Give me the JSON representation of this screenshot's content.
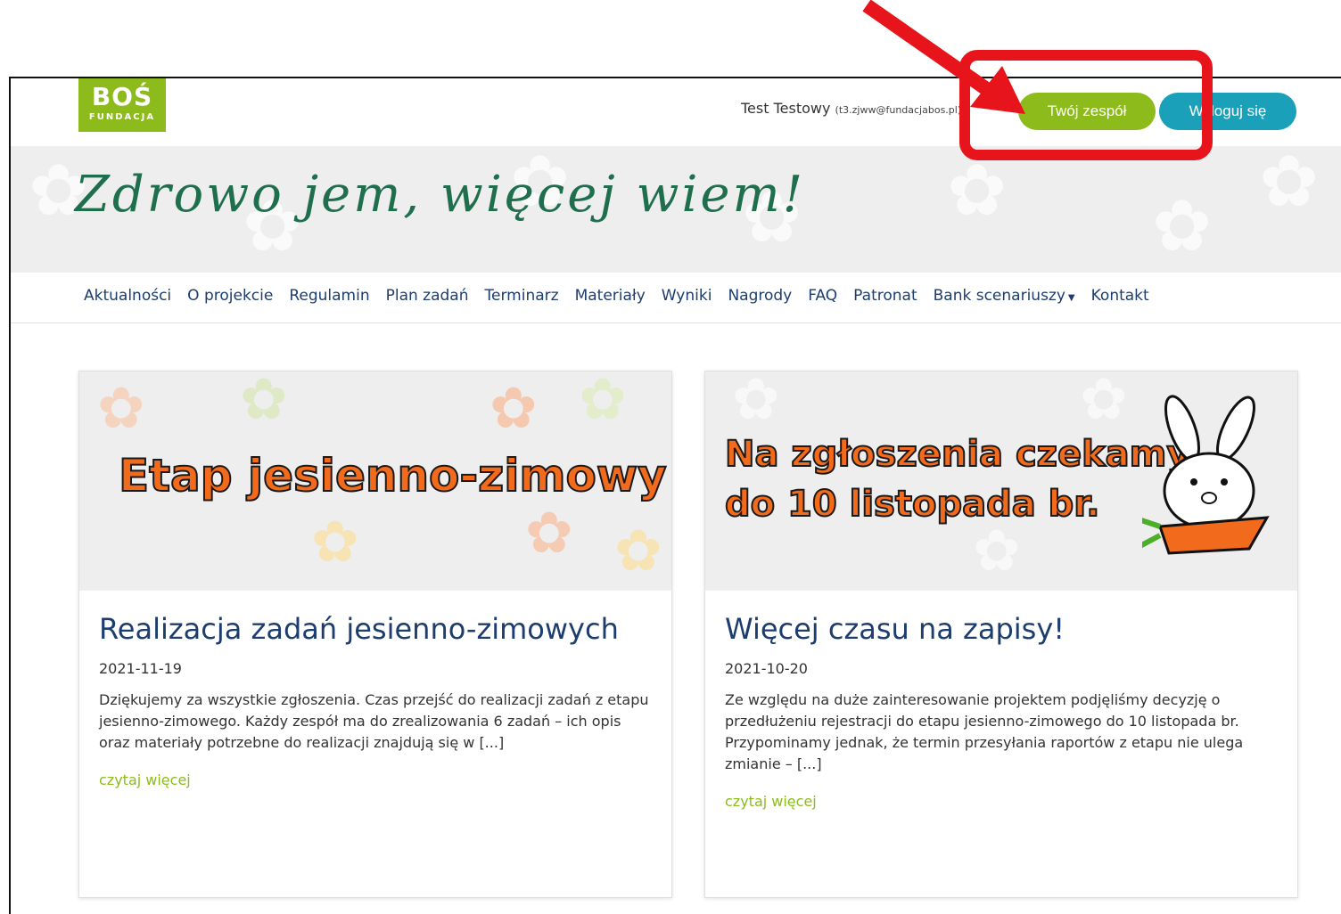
{
  "header": {
    "logo_big": "BOŚ",
    "logo_small": "FUNDACJA",
    "user_name": "Test Testowy",
    "user_email": "(t3.zjww@fundacjabos.pl)",
    "team_button": "Twój zespół",
    "logout_button": "Wyloguj się"
  },
  "banner": {
    "title": "Zdrowo jem, więcej wiem!"
  },
  "nav": {
    "items": [
      "Aktualności",
      "O projekcie",
      "Regulamin",
      "Plan zadań",
      "Terminarz",
      "Materiały",
      "Wyniki",
      "Nagrody",
      "FAQ",
      "Patronat",
      "Bank scenariuszy",
      "Kontakt"
    ]
  },
  "cards": [
    {
      "image_text": "Etap jesienno-zimowy",
      "title": "Realizacja zadań jesienno-zimowych",
      "date": "2021-11-19",
      "excerpt": "Dziękujemy za wszystkie zgłoszenia. Czas przejść do realizacji zadań z etapu jesienno-zimowego. Każdy zespół ma do zrealizowania 6 zadań – ich opis oraz materiały potrzebne do realizacji znajdują się w [...]",
      "more": "czytaj więcej"
    },
    {
      "image_text_line1": "Na zgłoszenia czekamy",
      "image_text_line2": "do 10 listopada br.",
      "title": "Więcej czasu na zapisy!",
      "date": "2021-10-20",
      "excerpt": "Ze względu na duże zainteresowanie projektem podjęliśmy decyzję o przedłużeniu rejestracji do etapu jesienno-zimowego do 10 listopada br. Przypominamy jednak, że termin przesyłania raportów z etapu nie ulega zmianie – [...]",
      "more": "czytaj więcej"
    }
  ],
  "colors": {
    "accent_green": "#8dbb1c",
    "accent_teal": "#1aa0b8",
    "nav_blue": "#1d3d6e",
    "annotation_red": "#e8141b"
  }
}
